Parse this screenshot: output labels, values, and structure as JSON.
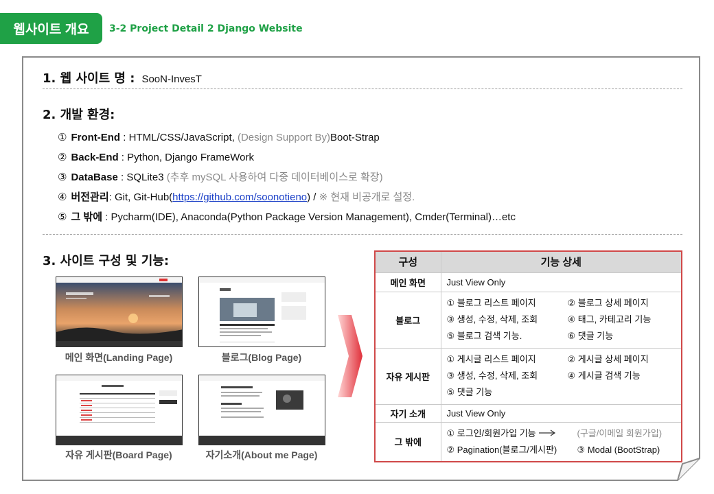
{
  "header": {
    "tab_label": "웹사이트 개요",
    "subtitle": "3-2 Project Detail 2 Django Website"
  },
  "section1": {
    "title": "1. 웹 사이트 명 :",
    "value": "SooN-InvesT"
  },
  "section2": {
    "title": "2. 개발 환경:",
    "items": [
      {
        "num": "①",
        "label": "Front-End",
        "text": " : HTML/CSS/JavaScript,  ",
        "gray": "(Design Support By)",
        "tail": "Boot-Strap"
      },
      {
        "num": "②",
        "label": "Back-End",
        "text": " : Python, Django FrameWork",
        "gray": "",
        "tail": ""
      },
      {
        "num": "③",
        "label": "DataBase",
        "text": " : SQLite3 ",
        "gray": "(추후 mySQL 사용하여 다중 데이터베이스로 확장)",
        "tail": ""
      },
      {
        "num": "④",
        "label": "버전관리",
        "text": ": Git, Git-Hub(",
        "link": "https://github.com/soonotieno",
        "after_link": ") / ",
        "gray": "※ 현재 비공개로 설정.",
        "tail": ""
      },
      {
        "num": "⑤",
        "label": "그 밖에",
        "text": " : Pycharm(IDE), Anaconda(Python Package Version Management), Cmder(Terminal)…etc",
        "gray": "",
        "tail": ""
      }
    ]
  },
  "section3": {
    "title": "3. 사이트 구성 및 기능:",
    "thumbnails": [
      {
        "caption": "메인 화면(Landing Page)"
      },
      {
        "caption": "블로그(Blog Page)"
      },
      {
        "caption": "자유 게시판(Board Page)"
      },
      {
        "caption": "자기소개(About me Page)"
      }
    ]
  },
  "table": {
    "head": [
      "구성",
      "기능 상세"
    ],
    "rows": [
      {
        "cat": "메인 화면",
        "single": "Just View Only"
      },
      {
        "cat": "블로그",
        "items": [
          "① 블로그 리스트 페이지",
          "② 블로그 상세 페이지",
          "③ 생성, 수정, 삭제, 조회",
          "④ 태그, 카테고리 기능",
          "⑤ 블로그 검색 기능.",
          "⑥ 댓글 기능"
        ]
      },
      {
        "cat": "자유 게시판",
        "items": [
          "① 게시글 리스트 페이지",
          "② 게시글 상세 페이지",
          "③ 생성, 수정, 삭제, 조회",
          "④ 게시글 검색 기능",
          "⑤ 댓글 기능",
          ""
        ]
      },
      {
        "cat": "자기 소개",
        "single": "Just View Only"
      },
      {
        "cat": "그 밖에",
        "items": [
          "① 로그인/회원가입 기능",
          "(구글/이메일 회원가입)",
          "② Pagination(블로그/게시판)",
          "③ Modal (BootStrap)"
        ]
      }
    ]
  },
  "colors": {
    "accent": "#1fa146",
    "table_border": "#d04848",
    "arrow": "#e0303a"
  }
}
